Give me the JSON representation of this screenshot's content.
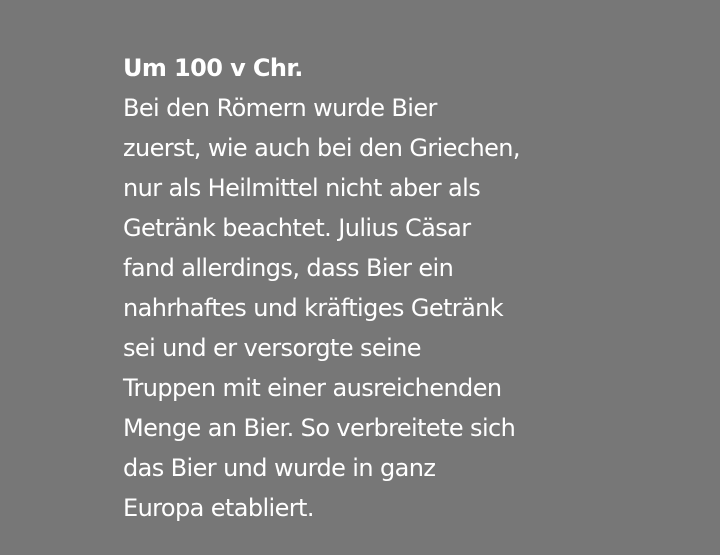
{
  "heading": "Um 100 v Chr.",
  "body_lines": [
    "Bei den Römern wurde Bier",
    "zuerst, wie auch bei den Griechen,",
    "nur als Heilmittel nicht aber als",
    "Getränk beachtet. Julius Cäsar",
    "fand allerdings, dass Bier ein",
    "nahrhaftes und kräftiges Getränk",
    "sei und er versorgte seine",
    "Truppen mit einer ausreichenden",
    "Menge an Bier. So verbreitete sich",
    "das Bier und wurde in ganz",
    "Europa etabliert."
  ],
  "colors": {
    "background": "#777777",
    "text": "#ffffff"
  }
}
